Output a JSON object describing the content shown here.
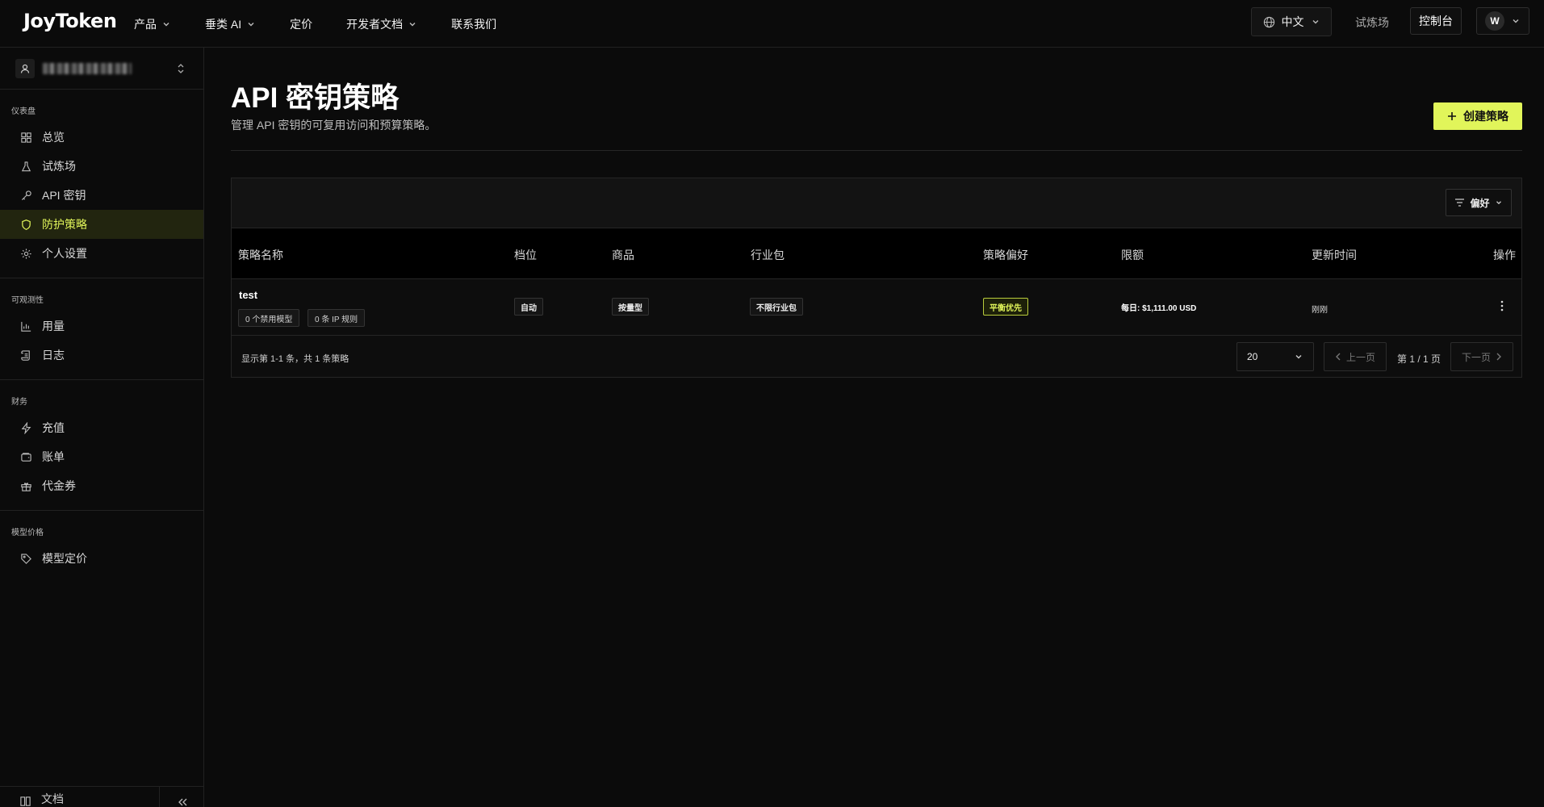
{
  "brand": {
    "logo": "JoyToken",
    "accent": "#e1f55a"
  },
  "nav": {
    "items": [
      {
        "label": "产品",
        "dropdown": true
      },
      {
        "label": "垂类 AI",
        "dropdown": true
      },
      {
        "label": "定价",
        "dropdown": false
      },
      {
        "label": "开发者文档",
        "dropdown": true
      },
      {
        "label": "联系我们",
        "dropdown": false
      }
    ],
    "language": "中文",
    "playground_link": "试炼场",
    "console_button": "控制台",
    "user_initial": "W"
  },
  "sidebar": {
    "sections": [
      {
        "heading": "仪表盘",
        "items": [
          {
            "label": "总览",
            "icon": "grid-icon"
          },
          {
            "label": "试炼场",
            "icon": "flask-icon"
          },
          {
            "label": "API 密钥",
            "icon": "key-icon"
          },
          {
            "label": "防护策略",
            "icon": "shield-icon",
            "active": true
          },
          {
            "label": "个人设置",
            "icon": "gear-icon"
          }
        ]
      },
      {
        "heading": "可观测性",
        "items": [
          {
            "label": "用量",
            "icon": "bar-chart-icon"
          },
          {
            "label": "日志",
            "icon": "scroll-icon"
          }
        ]
      },
      {
        "heading": "财务",
        "items": [
          {
            "label": "充值",
            "icon": "lightning-icon"
          },
          {
            "label": "账单",
            "icon": "wallet-icon"
          },
          {
            "label": "代金券",
            "icon": "gift-icon"
          }
        ]
      },
      {
        "heading": "模型价格",
        "items": [
          {
            "label": "模型定价",
            "icon": "tag-icon"
          }
        ]
      }
    ],
    "footer_doc": "文档"
  },
  "page": {
    "title": "API 密钥策略",
    "subtitle": "管理 API 密钥的可复用访问和预算策略。",
    "create_button": "创建策略",
    "preference_button": "偏好"
  },
  "table": {
    "columns": [
      "策略名称",
      "档位",
      "商品",
      "行业包",
      "策略偏好",
      "限额",
      "更新时间",
      "操作"
    ],
    "rows": [
      {
        "name": "test",
        "chips": [
          "0 个禁用模型",
          "0 条 IP 规则"
        ],
        "tier": "自动",
        "product": "按量型",
        "industry": "不限行业包",
        "preference": "平衡优先",
        "limit": "每日: $1,111.00 USD",
        "updated": "刚刚"
      }
    ]
  },
  "pagination": {
    "info": "显示第 1-1 条，共 1 条策略",
    "page_size": "20",
    "prev": "上一页",
    "status": "第 1 / 1 页",
    "next": "下一页"
  }
}
